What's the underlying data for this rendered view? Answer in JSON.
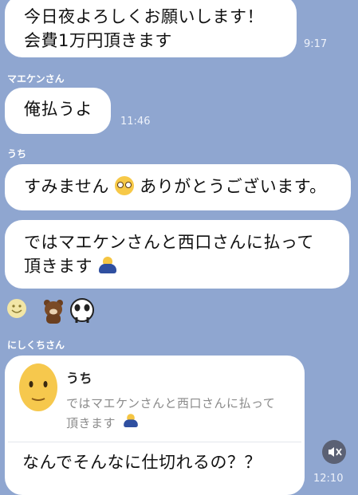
{
  "messages": {
    "m1": {
      "line1": "今日夜よろしくお願いします！",
      "line2": "会費1万円頂きます",
      "time": "9:17"
    },
    "m2": {
      "sender": "マエケンさん",
      "text": "俺払うよ",
      "time": "11:46"
    },
    "m3": {
      "sender": "うち",
      "text_a": "すみません",
      "text_b": "ありがとうございます。"
    },
    "m4": {
      "line1": "ではマエケンさんと西口さんに払って",
      "line2": "頂きます"
    },
    "reactions": [
      "smiley-face",
      "brown-bear-sticker",
      "panda-sticker"
    ],
    "m5": {
      "sender": "にしくちさん",
      "quote_sender": "うち",
      "quote_line1": "ではマエケンさんと西口さんに払って",
      "quote_line2": "頂きます",
      "reply": "なんでそんなに仕切れるの？？",
      "time": "12:10"
    }
  },
  "colors": {
    "background": "#8fa6d0",
    "bubble": "#ffffff"
  }
}
